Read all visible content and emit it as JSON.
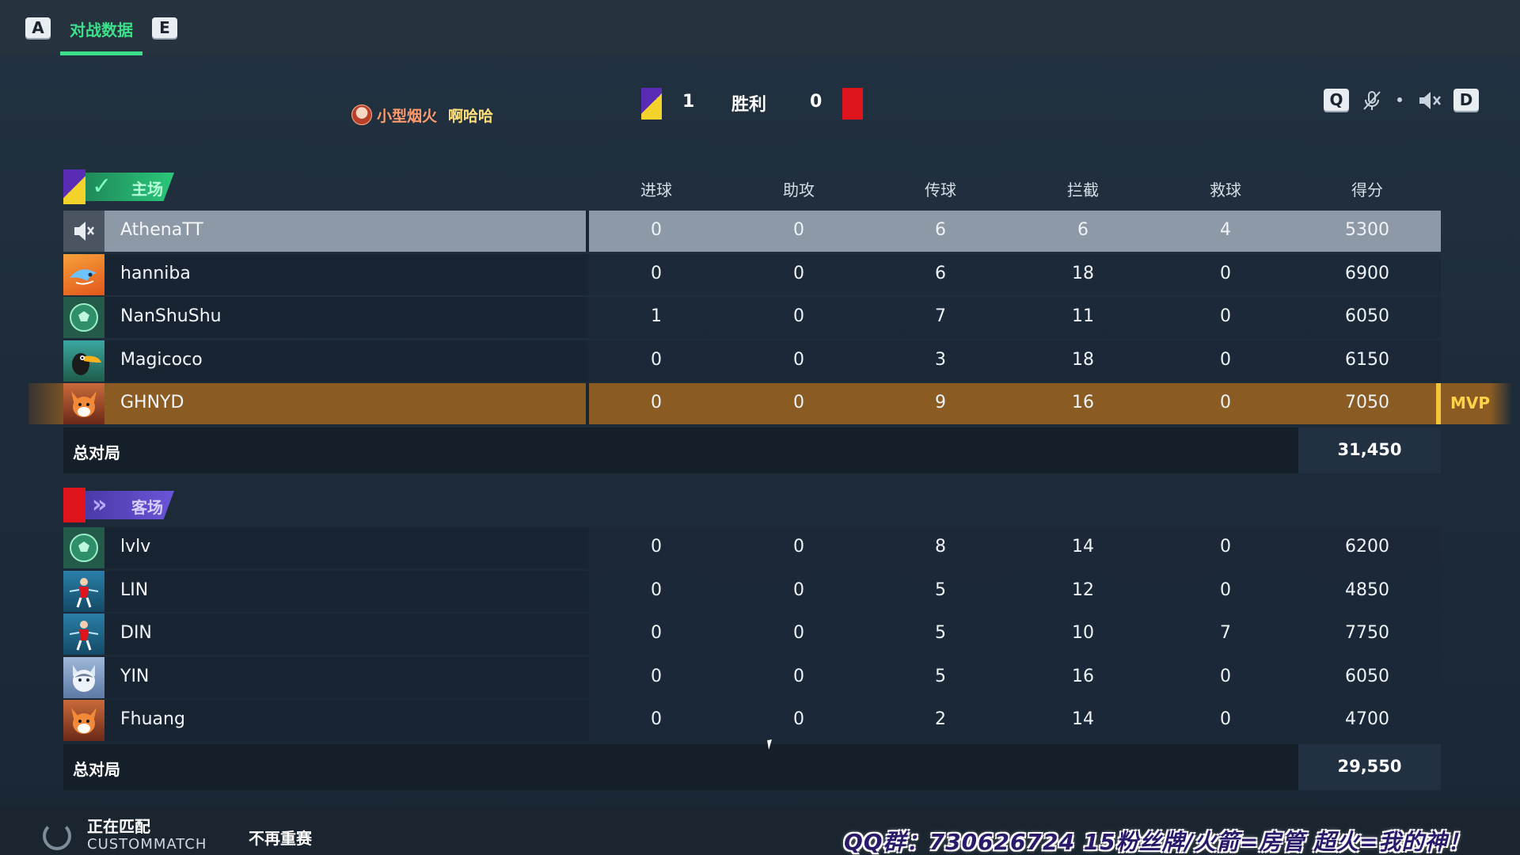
{
  "topbar": {
    "left_key": "A",
    "active_tab": "对战数据",
    "right_key": "E"
  },
  "header": {
    "streamer_name": "小型烟火",
    "streamer_tag": "啊哈哈",
    "home_score": "1",
    "result": "胜利",
    "away_score": "0",
    "left_key": "Q",
    "right_key": "D"
  },
  "columns": [
    "进球",
    "助攻",
    "传球",
    "拦截",
    "救球",
    "得分"
  ],
  "home": {
    "label": "主场",
    "players": [
      {
        "name": "AthenaTT",
        "stats": [
          "0",
          "0",
          "6",
          "6",
          "4",
          "5300"
        ]
      },
      {
        "name": "hanniba",
        "stats": [
          "0",
          "0",
          "6",
          "18",
          "0",
          "6900"
        ]
      },
      {
        "name": "NanShuShu",
        "stats": [
          "1",
          "0",
          "7",
          "11",
          "0",
          "6050"
        ]
      },
      {
        "name": "Magicoco",
        "stats": [
          "0",
          "0",
          "3",
          "18",
          "0",
          "6150"
        ]
      },
      {
        "name": "GHNYD",
        "stats": [
          "0",
          "0",
          "9",
          "16",
          "0",
          "7050"
        ]
      }
    ],
    "mvp_label": "MVP",
    "total_label": "总对局",
    "total_value": "31,450"
  },
  "away": {
    "label": "客场",
    "players": [
      {
        "name": "lvlv",
        "stats": [
          "0",
          "0",
          "8",
          "14",
          "0",
          "6200"
        ]
      },
      {
        "name": "LIN",
        "stats": [
          "0",
          "0",
          "5",
          "12",
          "0",
          "4850"
        ]
      },
      {
        "name": "DIN",
        "stats": [
          "0",
          "0",
          "5",
          "10",
          "7",
          "7750"
        ]
      },
      {
        "name": "YIN",
        "stats": [
          "0",
          "0",
          "5",
          "16",
          "0",
          "6050"
        ]
      },
      {
        "name": "Fhuang",
        "stats": [
          "0",
          "0",
          "2",
          "14",
          "0",
          "4700"
        ]
      }
    ],
    "total_label": "总对局",
    "total_value": "29,550"
  },
  "bottombar": {
    "status": "正在匹配",
    "mode": "CUSTOMMATCH",
    "no_rematch": "不再重赛",
    "overlay": "QQ群：730626724 15粉丝牌/火箭=房管 超火=我的神！"
  },
  "colors": {
    "accent_green": "#3ae08a",
    "home_purple": "#5a2bb5",
    "home_yellow": "#f4d22c",
    "away_red": "#e0141c",
    "mvp_gold": "#8a5c23"
  },
  "icons": {
    "mute_player": "speaker-mute-icon",
    "mic_off": "mic-off-icon",
    "speaker_mute": "speaker-mute-icon",
    "spinner": "loading-spinner-icon"
  }
}
